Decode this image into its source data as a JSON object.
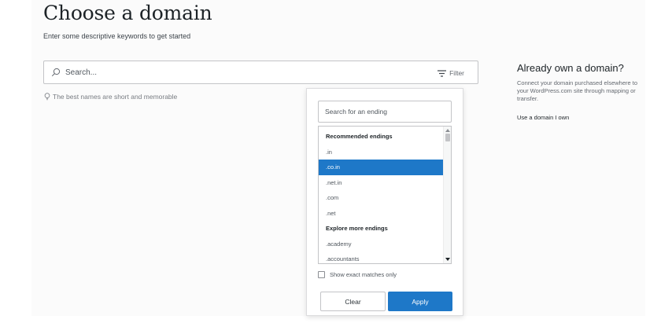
{
  "header": {
    "title": "Choose a domain",
    "subtitle": "Enter some descriptive keywords to get started"
  },
  "search": {
    "placeholder": "Search...",
    "filter_label": "Filter",
    "hint": "The best names are short and memorable"
  },
  "sidebar": {
    "title": "Already own a domain?",
    "description": "Connect your domain purchased elsewhere to your WordPress.com site through mapping or transfer.",
    "link": "Use a domain I own"
  },
  "filter_popover": {
    "search_placeholder": "Search for an ending",
    "groups": [
      {
        "label": "Recommended endings",
        "items": [
          {
            "label": ".in",
            "selected": false
          },
          {
            "label": ".co.in",
            "selected": true
          },
          {
            "label": ".net.in",
            "selected": false
          },
          {
            "label": ".com",
            "selected": false
          },
          {
            "label": ".net",
            "selected": false
          }
        ]
      },
      {
        "label": "Explore more endings",
        "items": [
          {
            "label": ".academy",
            "selected": false
          },
          {
            "label": ".accountants",
            "selected": false
          }
        ]
      }
    ],
    "exact_matches_label": "Show exact matches only",
    "clear_label": "Clear",
    "apply_label": "Apply"
  },
  "colors": {
    "accent": "#1e78c8",
    "text": "#1d2327",
    "muted": "#646970"
  },
  "icons": {
    "search": "search-icon",
    "filter": "filter-icon",
    "hint": "lightbulb-icon"
  }
}
